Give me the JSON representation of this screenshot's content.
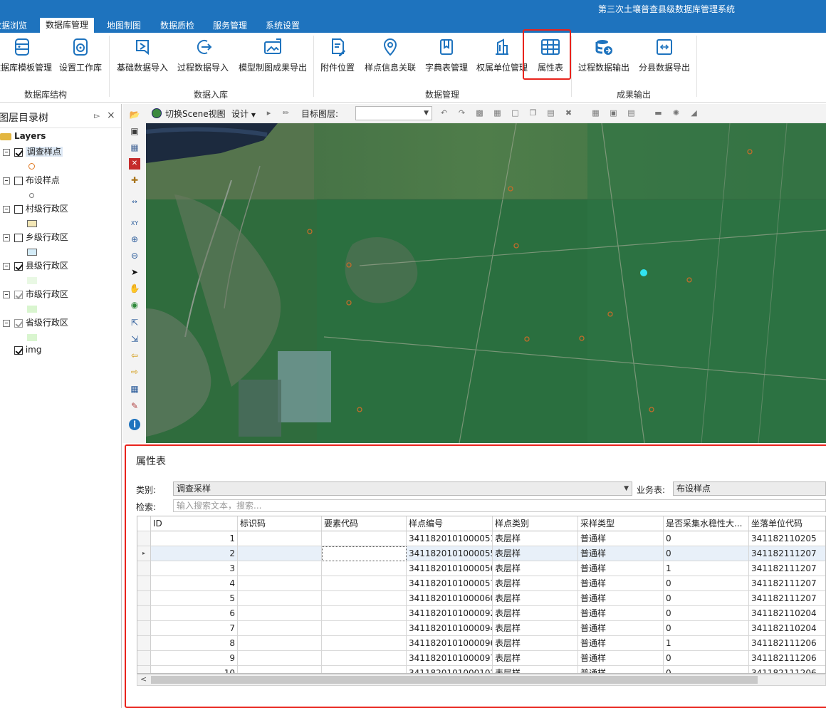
{
  "app": {
    "title": "第三次土壤普查县级数据库管理系统"
  },
  "menu": {
    "tabs": [
      {
        "label": "数据浏览",
        "active": false
      },
      {
        "label": "数据库管理",
        "active": true
      },
      {
        "label": "地图制图",
        "active": false
      },
      {
        "label": "数据质检",
        "active": false
      },
      {
        "label": "服务管理",
        "active": false
      },
      {
        "label": "系统设置",
        "active": false
      }
    ]
  },
  "ribbon": {
    "groups": [
      {
        "label": "数据库结构"
      },
      {
        "label": "数据入库"
      },
      {
        "label": "数据管理"
      },
      {
        "label": "成果输出"
      }
    ],
    "buttons": [
      {
        "label": "数据库模板管理",
        "icon": "database-template-icon"
      },
      {
        "label": "设置工作库",
        "icon": "database-settings-icon"
      },
      {
        "label": "基础数据导入",
        "icon": "basic-data-import-icon"
      },
      {
        "label": "过程数据导入",
        "icon": "process-data-import-icon"
      },
      {
        "label": "模型制图成果导出",
        "icon": "model-map-export-icon"
      },
      {
        "label": "附件位置",
        "icon": "attachment-icon"
      },
      {
        "label": "样点信息关联",
        "icon": "location-pin-icon"
      },
      {
        "label": "字典表管理",
        "icon": "dictionary-icon"
      },
      {
        "label": "权属单位管理",
        "icon": "building-icon"
      },
      {
        "label": "属性表",
        "icon": "table-icon",
        "highlighted": true
      },
      {
        "label": "过程数据输出",
        "icon": "database-export-icon"
      },
      {
        "label": "分县数据导出",
        "icon": "county-export-icon"
      }
    ]
  },
  "toc": {
    "title": "图层目录树",
    "root": "Layers",
    "layers": [
      {
        "label": "调查样点",
        "checked": true,
        "symbol": "point-orange",
        "selected": true
      },
      {
        "label": "布设样点",
        "checked": false,
        "symbol": "point-gray"
      },
      {
        "label": "村级行政区",
        "checked": false,
        "symbol": "#f3e7b6"
      },
      {
        "label": "乡级行政区",
        "checked": false,
        "symbol": "#d4ecf8"
      },
      {
        "label": "县级行政区",
        "checked": true,
        "symbol": "#e9f8e4"
      },
      {
        "label": "市级行政区",
        "checked": true,
        "dim": true,
        "symbol": "#d9f5cf"
      },
      {
        "label": "省级行政区",
        "checked": true,
        "dim": true,
        "symbol": "#d9f5cf"
      },
      {
        "label": "img",
        "checked": true,
        "symbol": ""
      }
    ]
  },
  "map_toolbar": {
    "scene_button": "切换Scene视图",
    "design_menu": "设计",
    "target_layer_label": "目标图层:",
    "target_layer_value": ""
  },
  "attribute_panel": {
    "title": "属性表",
    "category_label": "类别:",
    "category_value": "调查采样",
    "business_label": "业务表:",
    "business_value": "布设样点",
    "search_label": "检索:",
    "search_placeholder": "输入搜索文本，搜索...",
    "columns": [
      "ID",
      "标识码",
      "要素代码",
      "样点编号",
      "样点类别",
      "采样类型",
      "是否采集水稳性大...",
      "坐落单位代码"
    ],
    "rows": [
      {
        "id": "1",
        "code": "",
        "feature": "",
        "sample_no": "3411820101000051",
        "sample_cat": "表层样",
        "sample_type": "普通样",
        "water": "0",
        "unit": "341182110205"
      },
      {
        "id": "2",
        "code": "",
        "feature": "",
        "sample_no": "3411820101000055",
        "sample_cat": "表层样",
        "sample_type": "普通样",
        "water": "0",
        "unit": "341182111207",
        "selected": true
      },
      {
        "id": "3",
        "code": "",
        "feature": "",
        "sample_no": "3411820101000056",
        "sample_cat": "表层样",
        "sample_type": "普通样",
        "water": "1",
        "unit": "341182111207"
      },
      {
        "id": "4",
        "code": "",
        "feature": "",
        "sample_no": "3411820101000057",
        "sample_cat": "表层样",
        "sample_type": "普通样",
        "water": "0",
        "unit": "341182111207"
      },
      {
        "id": "5",
        "code": "",
        "feature": "",
        "sample_no": "3411820101000060",
        "sample_cat": "表层样",
        "sample_type": "普通样",
        "water": "0",
        "unit": "341182111207"
      },
      {
        "id": "6",
        "code": "",
        "feature": "",
        "sample_no": "3411820101000092",
        "sample_cat": "表层样",
        "sample_type": "普通样",
        "water": "0",
        "unit": "341182110204"
      },
      {
        "id": "7",
        "code": "",
        "feature": "",
        "sample_no": "3411820101000094",
        "sample_cat": "表层样",
        "sample_type": "普通样",
        "water": "0",
        "unit": "341182110204"
      },
      {
        "id": "8",
        "code": "",
        "feature": "",
        "sample_no": "3411820101000096",
        "sample_cat": "表层样",
        "sample_type": "普通样",
        "water": "1",
        "unit": "341182111206"
      },
      {
        "id": "9",
        "code": "",
        "feature": "",
        "sample_no": "3411820101000097",
        "sample_cat": "表层样",
        "sample_type": "普通样",
        "water": "0",
        "unit": "341182111206"
      },
      {
        "id": "10",
        "code": "",
        "feature": "",
        "sample_no": "3411820101000102",
        "sample_cat": "表层样",
        "sample_type": "普通样",
        "water": "0",
        "unit": "341182111206"
      }
    ]
  },
  "colors": {
    "titlebar": "#1e73be",
    "highlight": "#e8231c",
    "ribbon_icon": "#1e73be"
  }
}
